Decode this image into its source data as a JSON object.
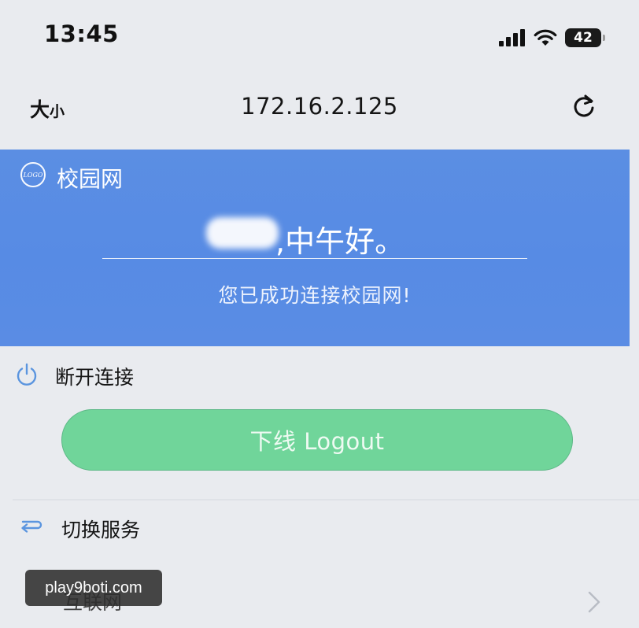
{
  "status_bar": {
    "time": "13:45",
    "battery": "42",
    "icons": [
      "signal-icon",
      "wifi-icon",
      "battery-icon"
    ]
  },
  "browser": {
    "text_size_big": "大",
    "text_size_small": "小",
    "url": "172.16.2.125",
    "reload_icon": "reload-icon"
  },
  "banner": {
    "logo_text": "LOGO",
    "site_name": "校园网",
    "greeting": ",中午好。",
    "connected_message": "您已成功连接校园网!",
    "background_color": "#5a8ce4"
  },
  "disconnect": {
    "icon": "power-icon",
    "label": "断开连接",
    "logout_button": "下线 Logout",
    "button_color": "#70d59a"
  },
  "switch_service": {
    "icon": "switch-icon",
    "label": "切换服务",
    "current_service": "互联网",
    "chevron_icon": "chevron-right-icon"
  },
  "watermark": {
    "text": "play9boti.com"
  }
}
